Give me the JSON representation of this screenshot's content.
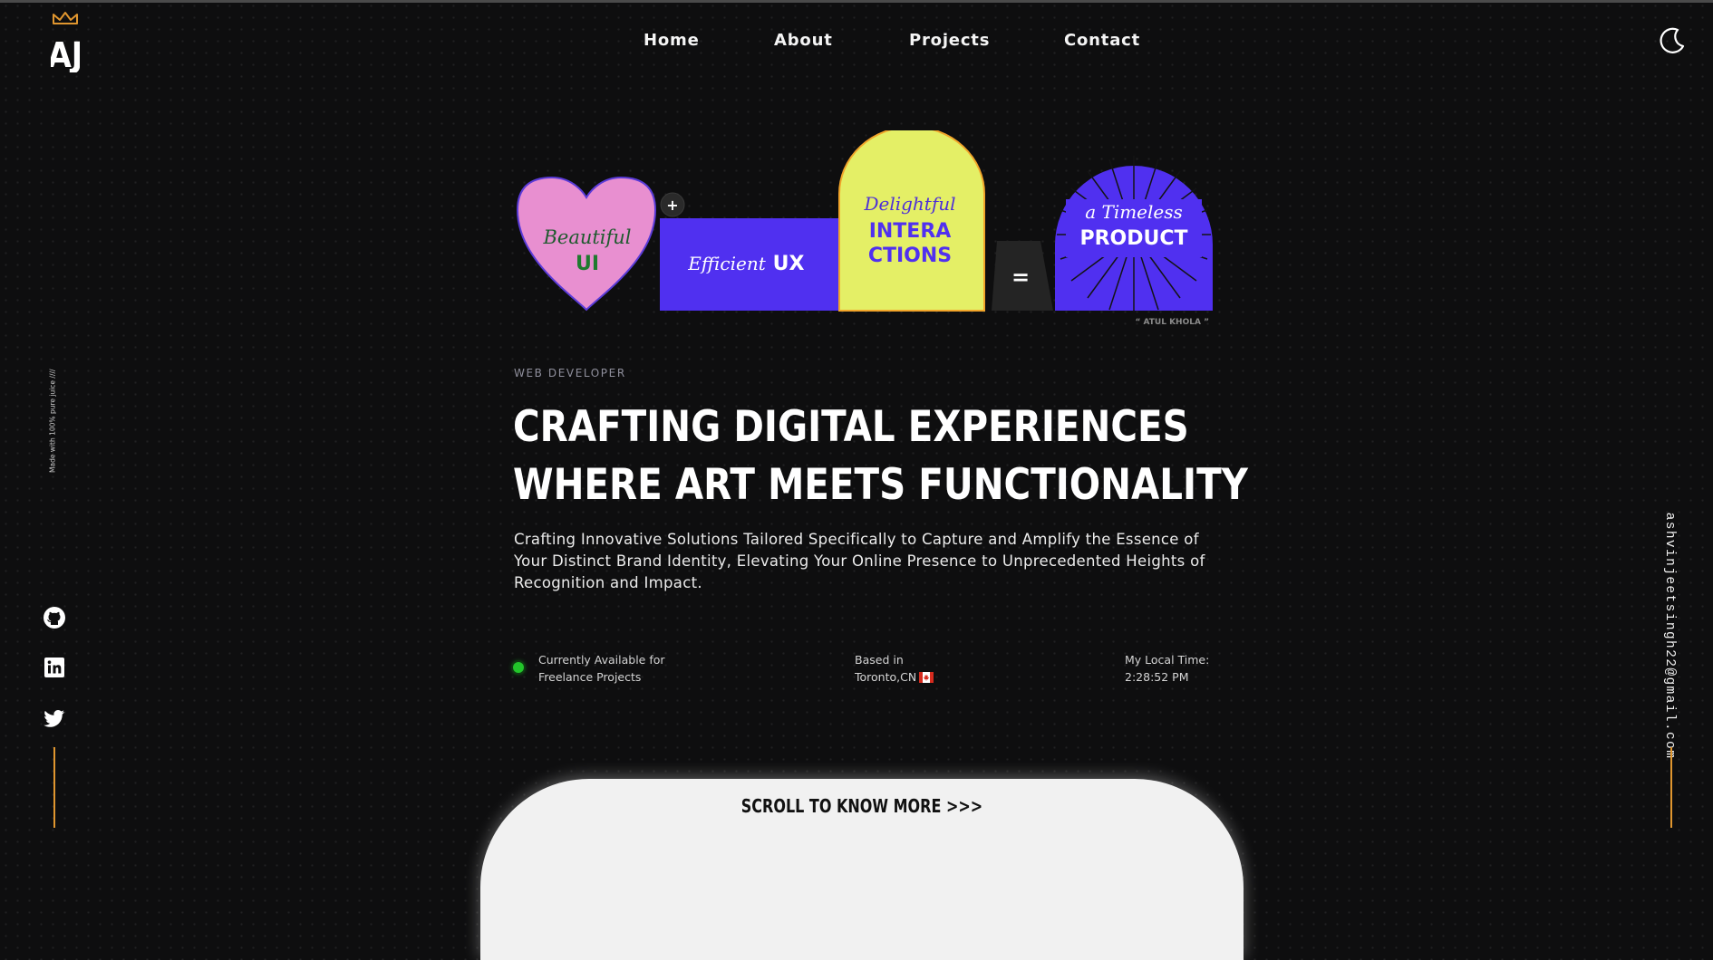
{
  "logo": {
    "text": "AJ",
    "crown_color": "#e0962f"
  },
  "nav": {
    "items": [
      {
        "label": "Home"
      },
      {
        "label": "About"
      },
      {
        "label": "Projects"
      },
      {
        "label": "Contact"
      }
    ],
    "theme_toggle_icon": "moon-icon"
  },
  "sidebar_left": {
    "made_with": "Made with 100% pure juice ////",
    "socials": [
      {
        "name": "github-icon"
      },
      {
        "name": "linkedin-icon"
      },
      {
        "name": "twitter-icon"
      }
    ],
    "line_color": "#e0962f"
  },
  "sidebar_right": {
    "email": "ashvinjeetsingh22@gmail.com"
  },
  "hero_graphic": {
    "heart": {
      "script": "Beautiful",
      "bold": "UI",
      "fill": "#e88fd0"
    },
    "plus": "+",
    "ux": {
      "script": "Efficient",
      "bold": "UX",
      "fill": "#5030f0"
    },
    "interactions": {
      "script": "Delightful",
      "bold_line1": "INTERA",
      "bold_line2": "CTIONS",
      "fill": "#e4ef66"
    },
    "equals": "=",
    "product": {
      "script": "a Timeless",
      "bold": "PRODUCT",
      "fill": "#5030f0"
    },
    "credit": "“ ATUL KHOLA ”"
  },
  "hero": {
    "eyebrow": "WEB DEVELOPER",
    "headline_line1": "CRAFTING DIGITAL EXPERIENCES",
    "headline_line2": "WHERE ART MEETS FUNCTIONALITY",
    "lede": "Crafting Innovative Solutions Tailored Specifically to Capture and Amplify the Essence of Your Distinct Brand Identity, Elevating Your Online Presence to Unprecedented Heights of Recognition and Impact."
  },
  "info": {
    "availability_line1": "Currently Available for",
    "availability_line2": "Freelance Projects",
    "based_label": "Based in",
    "based_value": "Toronto,CN",
    "time_label": "My Local Time:",
    "time_value": "2:28:52 PM",
    "status_color": "#22c52a"
  },
  "scroll": {
    "label": "SCROLL TO KNOW MORE >>>"
  }
}
